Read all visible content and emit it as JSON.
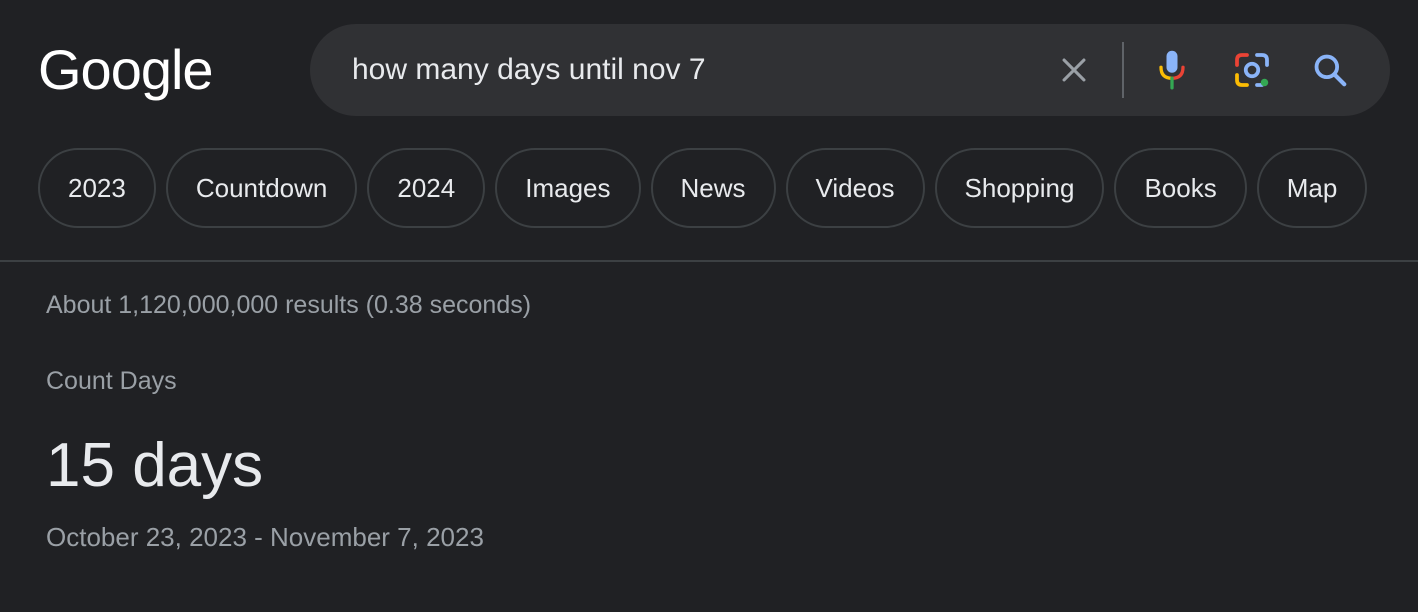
{
  "logo": {
    "text": "Google"
  },
  "search": {
    "query": "how many days until nov 7",
    "clear_icon": "close-icon",
    "mic_icon": "microphone-icon",
    "lens_icon": "google-lens-icon",
    "search_icon": "search-icon"
  },
  "chips": [
    {
      "label": "2023"
    },
    {
      "label": "Countdown"
    },
    {
      "label": "2024"
    },
    {
      "label": "Images"
    },
    {
      "label": "News"
    },
    {
      "label": "Videos"
    },
    {
      "label": "Shopping"
    },
    {
      "label": "Books"
    },
    {
      "label": "Map"
    }
  ],
  "results": {
    "stats": "About 1,120,000,000 results (0.38 seconds)"
  },
  "answer": {
    "label": "Count Days",
    "value": "15 days",
    "range": "October 23, 2023 - November 7, 2023"
  },
  "colors": {
    "background": "#202124",
    "searchbox": "#303134",
    "text_primary": "#e8eaed",
    "text_secondary": "#9aa0a6",
    "blue": "#8ab4f8",
    "red": "#ea4335",
    "yellow": "#fbbc04",
    "green": "#34a853"
  }
}
